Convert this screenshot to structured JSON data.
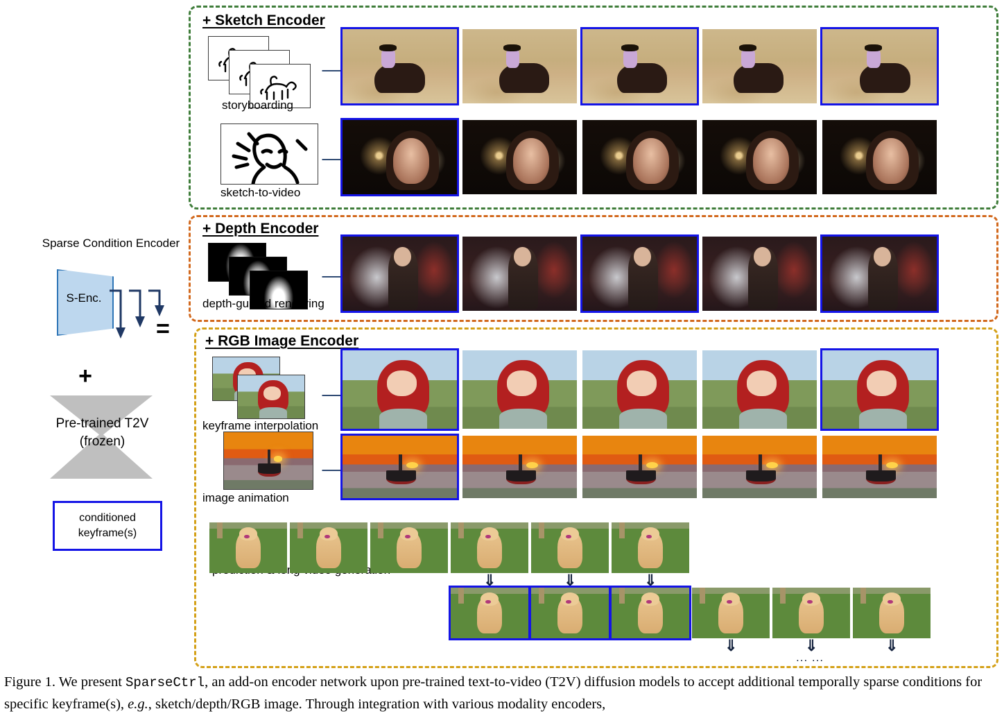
{
  "figure": {
    "caption_prefix": "Figure 1. We present ",
    "caption_mono": "SparseCtrl",
    "caption_part2": ", an add-on encoder network upon pre-trained text-to-video (T2V) diffusion models to accept additional temporally sparse conditions for specific keyframe(s), ",
    "caption_italic": "e.g.",
    "caption_part3": ", sketch/depth/RGB image. Through integration with various modality encoders,"
  },
  "left_diagram": {
    "encoder_title": "Sparse Condition Encoder",
    "encoder_block_label": "S-Enc.",
    "plus_symbol": "+",
    "equals_symbol": "=",
    "backbone_label": "Pre-trained T2V (frozen)",
    "legend_label": "conditioned keyframe(s)",
    "arrow_icon": "down-arrow-icon",
    "colors": {
      "encoder_fill": "#bdd7ee",
      "encoder_stroke": "#2e75b6",
      "backbone_fill": "#bfbfbf",
      "keyframe_border": "#1414e6"
    }
  },
  "sections": [
    {
      "id": "sketch",
      "title": "+ Sketch Encoder",
      "border_color": "#3f7d3a",
      "rows": [
        {
          "label": "storyboarding",
          "condition_type": "sketch-stack",
          "arrow": "right-arrow-icon",
          "frame_count": 5,
          "selected_frames": [
            1,
            3,
            5
          ],
          "content": "cowboy riding a horse across a grassy plain"
        },
        {
          "label": "sketch-to-video",
          "condition_type": "sketch-single",
          "arrow": "right-arrow-icon",
          "frame_count": 5,
          "selected_frames": [
            1
          ],
          "content": "woman with fireworks bursting behind her"
        }
      ]
    },
    {
      "id": "depth",
      "title": "+ Depth Encoder",
      "border_color": "#d2691e",
      "rows": [
        {
          "label": "depth-guided rendering",
          "condition_type": "depth-stack",
          "arrow": "right-arrow-icon",
          "frame_count": 5,
          "selected_frames": [
            1,
            3,
            5
          ],
          "content": "woman holding a phone on a foggy neon street"
        }
      ]
    },
    {
      "id": "rgb",
      "title": "+ RGB Image Encoder",
      "border_color": "#d4a017",
      "rows": [
        {
          "label": "keyframe interpolation",
          "condition_type": "rgb-stack-2",
          "arrow": "right-arrow-icon",
          "frame_count": 5,
          "selected_frames": [
            1,
            5
          ],
          "content": "anime girl with long red hair in a garden"
        },
        {
          "label": "image animation",
          "condition_type": "rgb-single",
          "arrow": "right-arrow-icon",
          "frame_count": 5,
          "selected_frames": [
            1
          ],
          "content": "fishing boat at sunset on the sea"
        },
        {
          "label": "prediction & long video generation",
          "condition_type": "none",
          "top_frame_count": 6,
          "bottom_frame_count": 6,
          "bottom_selected_frames": [
            1,
            2,
            3
          ],
          "top_arrow_icons": [
            "down-arrow-icon",
            "down-arrow-icon",
            "down-arrow-icon"
          ],
          "bottom_arrow_icons": [
            "down-arrow-icon",
            "down-arrow-icon",
            "down-arrow-icon"
          ],
          "ellipsis": "... ...",
          "content": "golden retriever sitting on grass"
        }
      ]
    }
  ]
}
